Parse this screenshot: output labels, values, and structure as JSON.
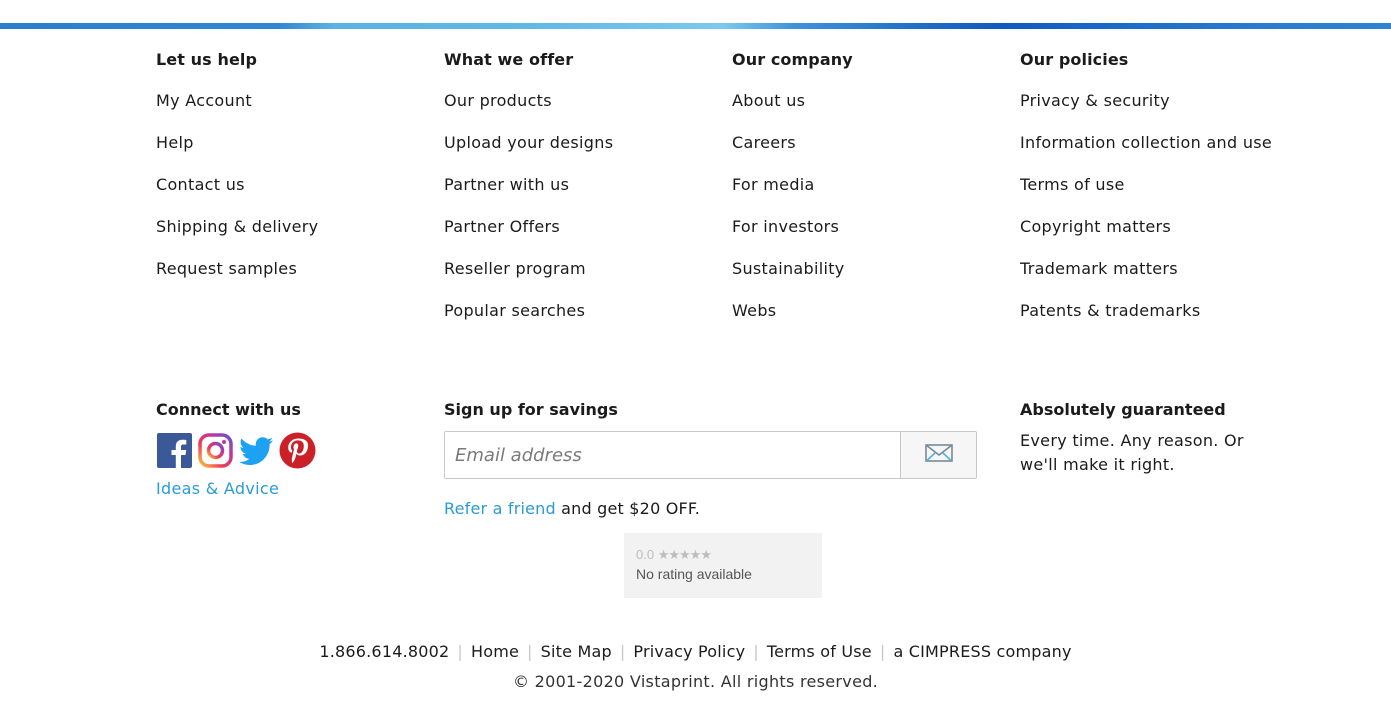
{
  "columns": [
    {
      "title": "Let us help",
      "links": [
        "My Account",
        "Help",
        "Contact us",
        "Shipping & delivery",
        "Request samples"
      ]
    },
    {
      "title": "What we offer",
      "links": [
        "Our products",
        "Upload your designs",
        "Partner with us",
        "Partner Offers",
        "Reseller program",
        "Popular searches"
      ]
    },
    {
      "title": "Our company",
      "links": [
        "About us",
        "Careers",
        "For media",
        "For investors",
        "Sustainability",
        "Webs"
      ]
    },
    {
      "title": "Our policies",
      "links": [
        "Privacy & security",
        "Information collection and use",
        "Terms of use",
        "Copyright matters",
        "Trademark matters",
        "Patents & trademarks"
      ]
    }
  ],
  "connect": {
    "title": "Connect with us",
    "social_icons": [
      "facebook-icon",
      "instagram-icon",
      "twitter-icon",
      "pinterest-icon"
    ],
    "ideas_link": "Ideas & Advice"
  },
  "signup": {
    "title": "Sign up for savings",
    "email_placeholder": "Email address",
    "refer_link": "Refer a friend",
    "refer_text": " and get $20 OFF."
  },
  "rating": {
    "score": "0.0",
    "stars": "★★★★★",
    "text": "No rating available"
  },
  "guarantee": {
    "title": "Absolutely guaranteed",
    "text": "Every time. Any reason. Or we'll make it right."
  },
  "bottom": {
    "phone": "1.866.614.8002",
    "separator": "|",
    "links": [
      "Home",
      "Site Map",
      "Privacy Policy",
      "Terms of Use"
    ],
    "company": "a CIMPRESS company",
    "copyright": "© 2001-2020 Vistaprint. All rights reserved."
  },
  "colors": {
    "link_blue": "#2a9bd6",
    "text": "#1b1b1b",
    "facebook": "#3b5998",
    "twitter": "#1da1f2",
    "pinterest": "#cb2027"
  }
}
